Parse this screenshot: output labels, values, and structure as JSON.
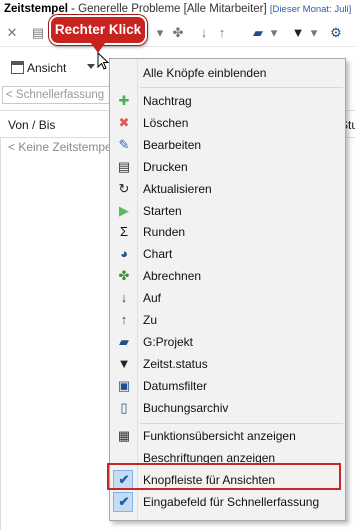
{
  "window": {
    "title_app": "Zeitstempel",
    "title_sep": " - ",
    "title_context": "Generelle Probleme [Alle Mitarbeiter]",
    "title_filter": "[Dieser Monat: Juli]"
  },
  "callout": {
    "text": "Rechter Klick"
  },
  "toolbar": {
    "view_button": "Ansicht",
    "icons": [
      "close-icon",
      "print-icon",
      "down-arrow-icon",
      "up-arrow-icon",
      "folder-icon",
      "filter-icon",
      "settings-icon"
    ]
  },
  "quick_entry": {
    "placeholder": "< Schnellerfassung"
  },
  "grid": {
    "columns": [
      "Von / Bis",
      "Stu"
    ],
    "empty_text": "< Keine Zeitstempel"
  },
  "menu": {
    "show_all": "Alle Knöpfe einblenden",
    "items": [
      {
        "label": "Nachtrag",
        "icon": "plus-icon",
        "color": "#4caf50"
      },
      {
        "label": "Löschen",
        "icon": "x-icon",
        "color": "#e05a4f"
      },
      {
        "label": "Bearbeiten",
        "icon": "edit-icon",
        "color": "#2a6db3"
      },
      {
        "label": "Drucken",
        "icon": "print-icon",
        "color": "#333333"
      },
      {
        "label": "Aktualisieren",
        "icon": "refresh-icon",
        "color": "#222222"
      },
      {
        "label": "Starten",
        "icon": "play-icon",
        "color": "#5cb85c"
      },
      {
        "label": "Runden",
        "icon": "sigma-icon",
        "color": "#111111"
      },
      {
        "label": "Chart",
        "icon": "pie-chart-icon",
        "color": "#1f4e8a"
      },
      {
        "label": "Abrechnen",
        "icon": "billing-icon",
        "color": "#3a8f3a"
      },
      {
        "label": "Auf",
        "icon": "sort-up-icon",
        "color": "#1f4e8a"
      },
      {
        "label": "Zu",
        "icon": "sort-down-icon",
        "color": "#1f4e8a"
      },
      {
        "label": "G:Projekt",
        "icon": "folder-icon",
        "color": "#1f4e8a"
      },
      {
        "label": "Zeitst.status",
        "icon": "filter-icon",
        "color": "#222222"
      },
      {
        "label": "Datumsfilter",
        "icon": "calendar-icon",
        "color": "#1f4e8a"
      },
      {
        "label": "Buchungsarchiv",
        "icon": "archive-icon",
        "color": "#1f4e8a"
      }
    ],
    "footer": {
      "overview": "Funktionsübersicht anzeigen",
      "labels": "Beschriftungen anzeigen",
      "view_toolbar": "Knopfleiste für Ansichten",
      "quick_entry_field": "Eingabefeld für Schnellerfassung"
    }
  },
  "colors": {
    "callout": "#c8231f",
    "highlight_frame": "#c62828",
    "check_highlight": "#c5dcf2"
  }
}
